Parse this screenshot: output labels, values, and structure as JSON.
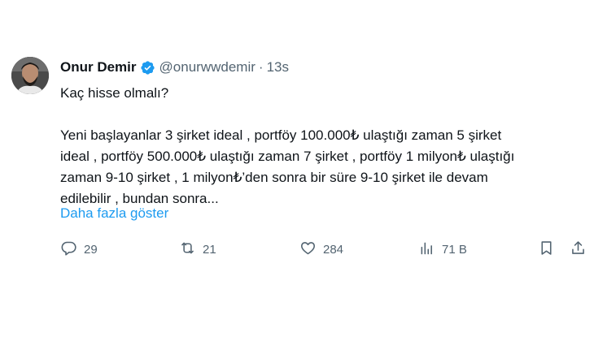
{
  "tweet": {
    "author_name": "Onur Demir",
    "handle": "@onurwwdemir",
    "separator": "·",
    "time": "13s",
    "title_line": "Kaç hisse olmalı?",
    "body_lines": [
      "Yeni başlayanlar 3 şirket ideal , portföy 100.000₺ ulaştığı zaman 5 şirket",
      "ideal , portföy 500.000₺ ulaştığı zaman 7 şirket , portföy 1 milyon₺ ulaştığı",
      "zaman 9-10 şirket , 1 milyon₺’den sonra bir süre 9-10 şirket ile devam",
      "edilebilir , bundan sonra..."
    ],
    "show_more": "Daha fazla göster"
  },
  "actions": {
    "replies": "29",
    "retweets": "21",
    "likes": "284",
    "views": "71 B"
  },
  "colors": {
    "accent": "#1d9bf0",
    "text": "#0f1419",
    "muted": "#536471"
  },
  "icons": [
    "verified-badge-icon",
    "reply-icon",
    "retweet-icon",
    "like-icon",
    "views-icon",
    "bookmark-icon",
    "share-icon"
  ]
}
